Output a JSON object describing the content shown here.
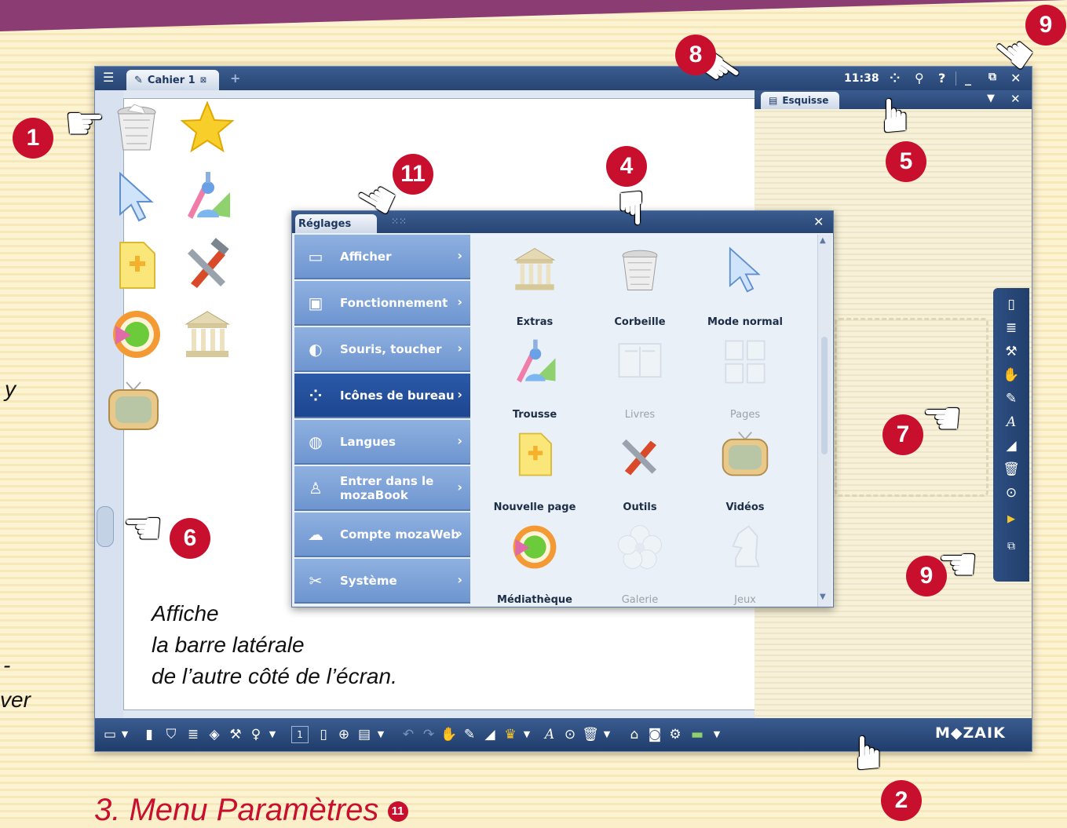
{
  "window": {
    "tab_title": "Cahier 1",
    "tab_close": "⊠",
    "new_tab": "+",
    "clock": "11:38",
    "titlebar_icons": [
      "apps-icon",
      "search-icon",
      "help-icon",
      "minimize-icon",
      "detach-icon",
      "close-icon"
    ]
  },
  "desktop_icons": [
    "trash-icon",
    "star-icon",
    "pointer-icon",
    "toolkit-icon",
    "new-page-icon",
    "tools-icon",
    "media-icon",
    "museum-icon",
    "tv-icon"
  ],
  "esquisse_panel": {
    "tab_label": "Esquisse"
  },
  "settings": {
    "tab_label": "Réglages",
    "menu": [
      {
        "label": "Afficher",
        "icon": "monitor-icon",
        "active": false
      },
      {
        "label": "Fonctionnement",
        "icon": "window-icon",
        "active": false
      },
      {
        "label": "Souris, toucher",
        "icon": "mouse-icon",
        "active": false
      },
      {
        "label": "Icônes de bureau",
        "icon": "grid-icon",
        "active": true
      },
      {
        "label": "Langues",
        "icon": "globe-icon",
        "active": false
      },
      {
        "label": "Entrer dans le mozaBook",
        "icon": "user-icon",
        "active": false
      },
      {
        "label": "Compte mozaWeb",
        "icon": "cloud-user-icon",
        "active": false
      },
      {
        "label": "Système",
        "icon": "system-icon",
        "active": false
      }
    ],
    "items": [
      {
        "label": "Extras",
        "icon": "museum-icon",
        "enabled": true
      },
      {
        "label": "Corbeille",
        "icon": "trash-icon",
        "enabled": true
      },
      {
        "label": "Mode normal",
        "icon": "pointer-icon",
        "enabled": true
      },
      {
        "label": "Trousse",
        "icon": "toolkit-icon",
        "enabled": true
      },
      {
        "label": "Livres",
        "icon": "book-icon",
        "enabled": false
      },
      {
        "label": "Pages",
        "icon": "pages-icon",
        "enabled": false
      },
      {
        "label": "Nouvelle page",
        "icon": "new-page-icon",
        "enabled": true
      },
      {
        "label": "Outils",
        "icon": "tools-icon",
        "enabled": true
      },
      {
        "label": "Vidéos",
        "icon": "tv-icon",
        "enabled": true
      },
      {
        "label": "Médiathèque",
        "icon": "media-icon",
        "enabled": true
      },
      {
        "label": "Galerie",
        "icon": "flower-icon",
        "enabled": false
      },
      {
        "label": "Jeux",
        "icon": "chess-knight-icon",
        "enabled": false
      }
    ]
  },
  "bottom_toolbar": {
    "page_number": "1",
    "brand": "M◆ZAIK"
  },
  "callouts": [
    "1",
    "2",
    "4",
    "5",
    "6",
    "7",
    "8",
    "9",
    "9",
    "11"
  ],
  "caption": {
    "line1": "Affiche",
    "line2": "la barre latérale",
    "line3": "de l’autre côté de l’écran."
  },
  "side_text": {
    "a": "y",
    "b": "-",
    "c": "ver"
  },
  "bottom_title": {
    "text": "3. Menu Paramètres",
    "badge": "11"
  },
  "colors": {
    "accent_red": "#c8102e",
    "titlebar_blue": "#274574",
    "menu_blue": "#6e95d0",
    "active_blue": "#1d4590"
  }
}
